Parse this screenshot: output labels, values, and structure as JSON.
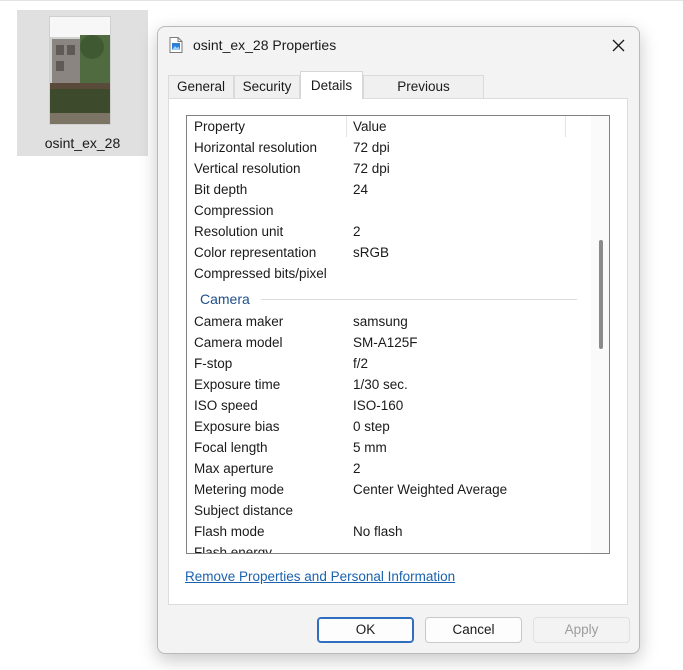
{
  "desktop": {
    "file_label": "osint_ex_28"
  },
  "dialog": {
    "title": "osint_ex_28 Properties",
    "tabs": [
      {
        "label": "General",
        "active": false
      },
      {
        "label": "Security",
        "active": false
      },
      {
        "label": "Details",
        "active": true
      },
      {
        "label": "Previous Versions",
        "active": false
      }
    ],
    "list": {
      "header": {
        "property": "Property",
        "value": "Value"
      },
      "image_rows": [
        {
          "name": "Horizontal resolution",
          "value": "72 dpi"
        },
        {
          "name": "Vertical resolution",
          "value": "72 dpi"
        },
        {
          "name": "Bit depth",
          "value": "24"
        },
        {
          "name": "Compression",
          "value": ""
        },
        {
          "name": "Resolution unit",
          "value": "2"
        },
        {
          "name": "Color representation",
          "value": "sRGB"
        },
        {
          "name": "Compressed bits/pixel",
          "value": ""
        }
      ],
      "camera_group": "Camera",
      "camera_rows": [
        {
          "name": "Camera maker",
          "value": "samsung"
        },
        {
          "name": "Camera model",
          "value": "SM-A125F"
        },
        {
          "name": "F-stop",
          "value": "f/2"
        },
        {
          "name": "Exposure time",
          "value": "1/30 sec."
        },
        {
          "name": "ISO speed",
          "value": "ISO-160"
        },
        {
          "name": "Exposure bias",
          "value": "0 step"
        },
        {
          "name": "Focal length",
          "value": "5 mm"
        },
        {
          "name": "Max aperture",
          "value": "2"
        },
        {
          "name": "Metering mode",
          "value": "Center Weighted Average"
        },
        {
          "name": "Subject distance",
          "value": ""
        },
        {
          "name": "Flash mode",
          "value": "No flash"
        },
        {
          "name": "Flash energy",
          "value": ""
        }
      ]
    },
    "remove_link": "Remove Properties and Personal Information",
    "buttons": {
      "ok": "OK",
      "cancel": "Cancel",
      "apply": "Apply"
    }
  },
  "colors": {
    "accent": "#2f6dbf",
    "link": "#1a62b0",
    "group_heading": "#1f4e8c"
  }
}
